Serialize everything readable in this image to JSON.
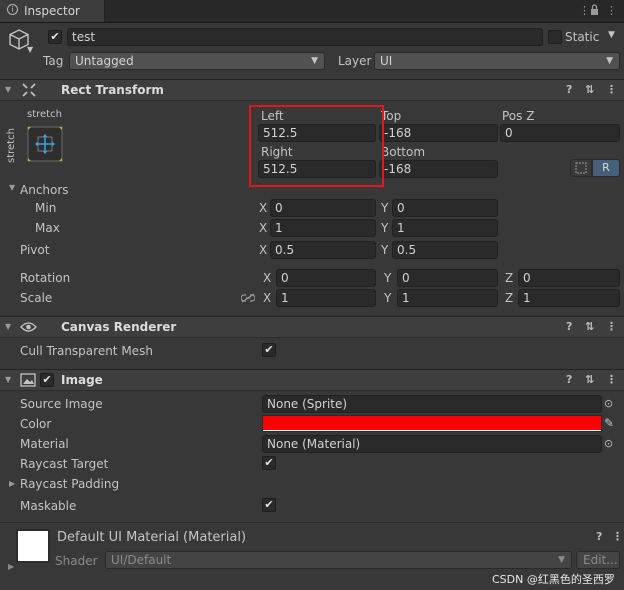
{
  "tab": {
    "title": "Inspector"
  },
  "object": {
    "name": "test",
    "static_label": "Static",
    "tag_label": "Tag",
    "tag_value": "Untagged",
    "layer_label": "Layer",
    "layer_value": "UI"
  },
  "rect_transform": {
    "title": "Rect Transform",
    "anchor_preset_h": "stretch",
    "anchor_preset_v": "stretch",
    "fields": {
      "left_label": "Left",
      "left_value": "512.5",
      "top_label": "Top",
      "top_value": "-168",
      "posz_label": "Pos Z",
      "posz_value": "0",
      "right_label": "Right",
      "right_value": "512.5",
      "bottom_label": "Bottom",
      "bottom_value": "-168"
    },
    "r_button": "R",
    "anchors_label": "Anchors",
    "min_label": "Min",
    "min_x": "0",
    "min_y": "0",
    "max_label": "Max",
    "max_x": "1",
    "max_y": "1",
    "pivot_label": "Pivot",
    "pivot_x": "0.5",
    "pivot_y": "0.5",
    "rotation_label": "Rotation",
    "rot_x": "0",
    "rot_y": "0",
    "rot_z": "0",
    "scale_label": "Scale",
    "scale_x": "1",
    "scale_y": "1",
    "scale_z": "1",
    "axis_x": "X",
    "axis_y": "Y",
    "axis_z": "Z"
  },
  "canvas_renderer": {
    "title": "Canvas Renderer",
    "cull_label": "Cull Transparent Mesh"
  },
  "image": {
    "title": "Image",
    "source_label": "Source Image",
    "source_value": "None (Sprite)",
    "color_label": "Color",
    "color_value": "#ff0000",
    "material_label": "Material",
    "material_value": "None (Material)",
    "raycast_target_label": "Raycast Target",
    "raycast_padding_label": "Raycast Padding",
    "maskable_label": "Maskable"
  },
  "material_preview": {
    "title": "Default UI Material (Material)",
    "shader_label": "Shader",
    "shader_value": "UI/Default",
    "edit_label": "Edit..."
  },
  "highlight_color": "#e0191e",
  "watermark": "CSDN @红黑色的圣西罗"
}
